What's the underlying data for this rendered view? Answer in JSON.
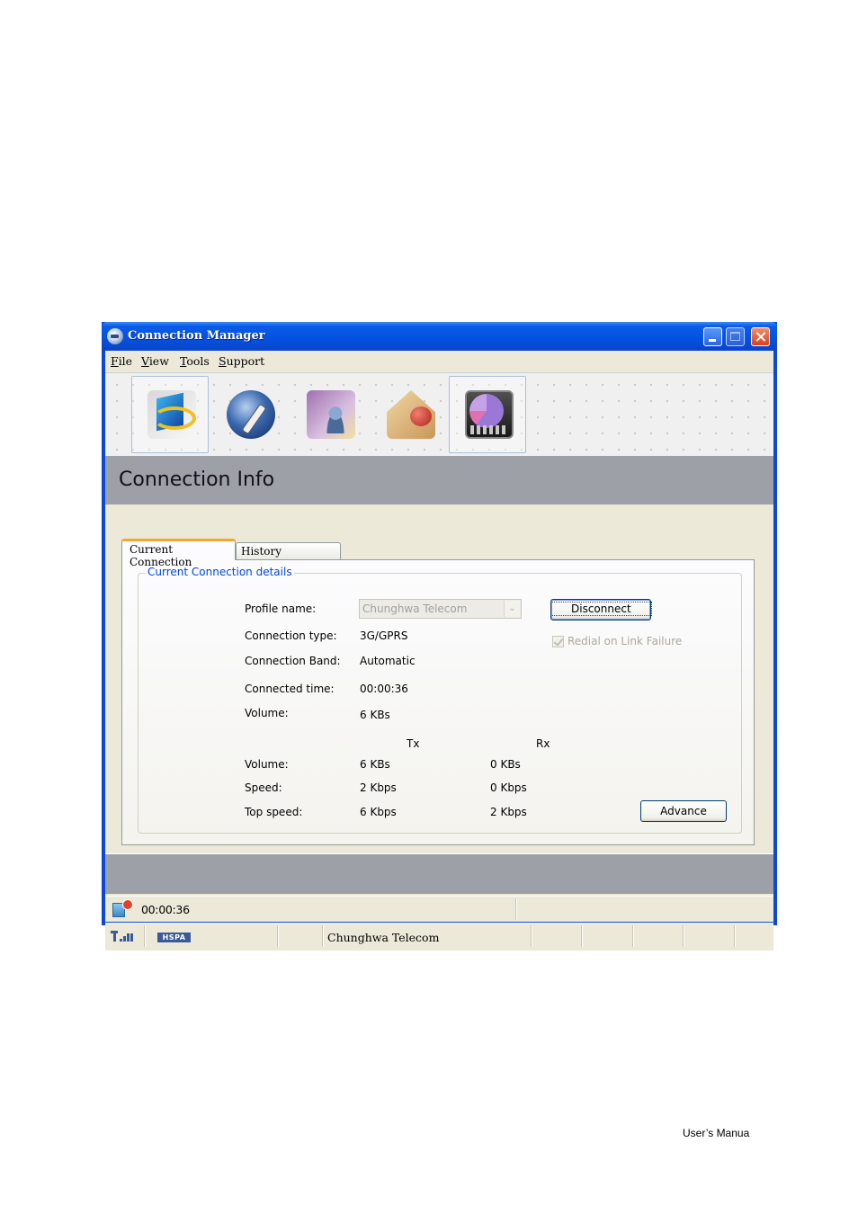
{
  "window": {
    "title": "Connection Manager"
  },
  "menu": {
    "items": [
      {
        "label": "File"
      },
      {
        "label": "View"
      },
      {
        "label": "Tools"
      },
      {
        "label": "Support"
      }
    ]
  },
  "toolbar": {
    "buttons": [
      {
        "name": "connect",
        "icon": "connect-monitor-icon"
      },
      {
        "name": "settings",
        "icon": "globe-wrench-icon"
      },
      {
        "name": "contacts",
        "icon": "phonebook-contacts-icon"
      },
      {
        "name": "sms",
        "icon": "envelope-message-icon"
      },
      {
        "name": "statistics",
        "icon": "pie-chart-stats-icon",
        "active": true
      }
    ]
  },
  "header": {
    "title": "Connection Info"
  },
  "tabs": [
    {
      "label": "Current Connection",
      "selected": true
    },
    {
      "label": "History Connection",
      "selected": false
    }
  ],
  "details": {
    "group_title": "Current Connection details",
    "profile_label": "Profile name:",
    "profile_value": "Chunghwa Telecom",
    "type_label": "Connection type:",
    "type_value": "3G/GPRS",
    "band_label": "Connection Band:",
    "band_value": "Automatic",
    "time_label": "Connected time:",
    "time_value": "00:00:36",
    "volume_label": "Volume:",
    "volume_value": "6 KBs",
    "disconnect_label": "Disconnect",
    "redial_label": "Redial on Link Failure",
    "redial_checked": true,
    "advance_label": "Advance"
  },
  "traffic": {
    "tx_header": "Tx",
    "rx_header": "Rx",
    "rows": [
      {
        "label": "Volume:",
        "tx": "6 KBs",
        "rx": "0 KBs"
      },
      {
        "label": "Speed:",
        "tx": "2 Kbps",
        "rx": "0 Kbps"
      },
      {
        "label": "Top speed:",
        "tx": "6 Kbps",
        "rx": "2 Kbps"
      }
    ]
  },
  "status": {
    "connected_time": "00:00:36",
    "network_type": "HSPA",
    "operator": "Chunghwa Telecom"
  },
  "page": {
    "footer": "User’s Manua"
  }
}
